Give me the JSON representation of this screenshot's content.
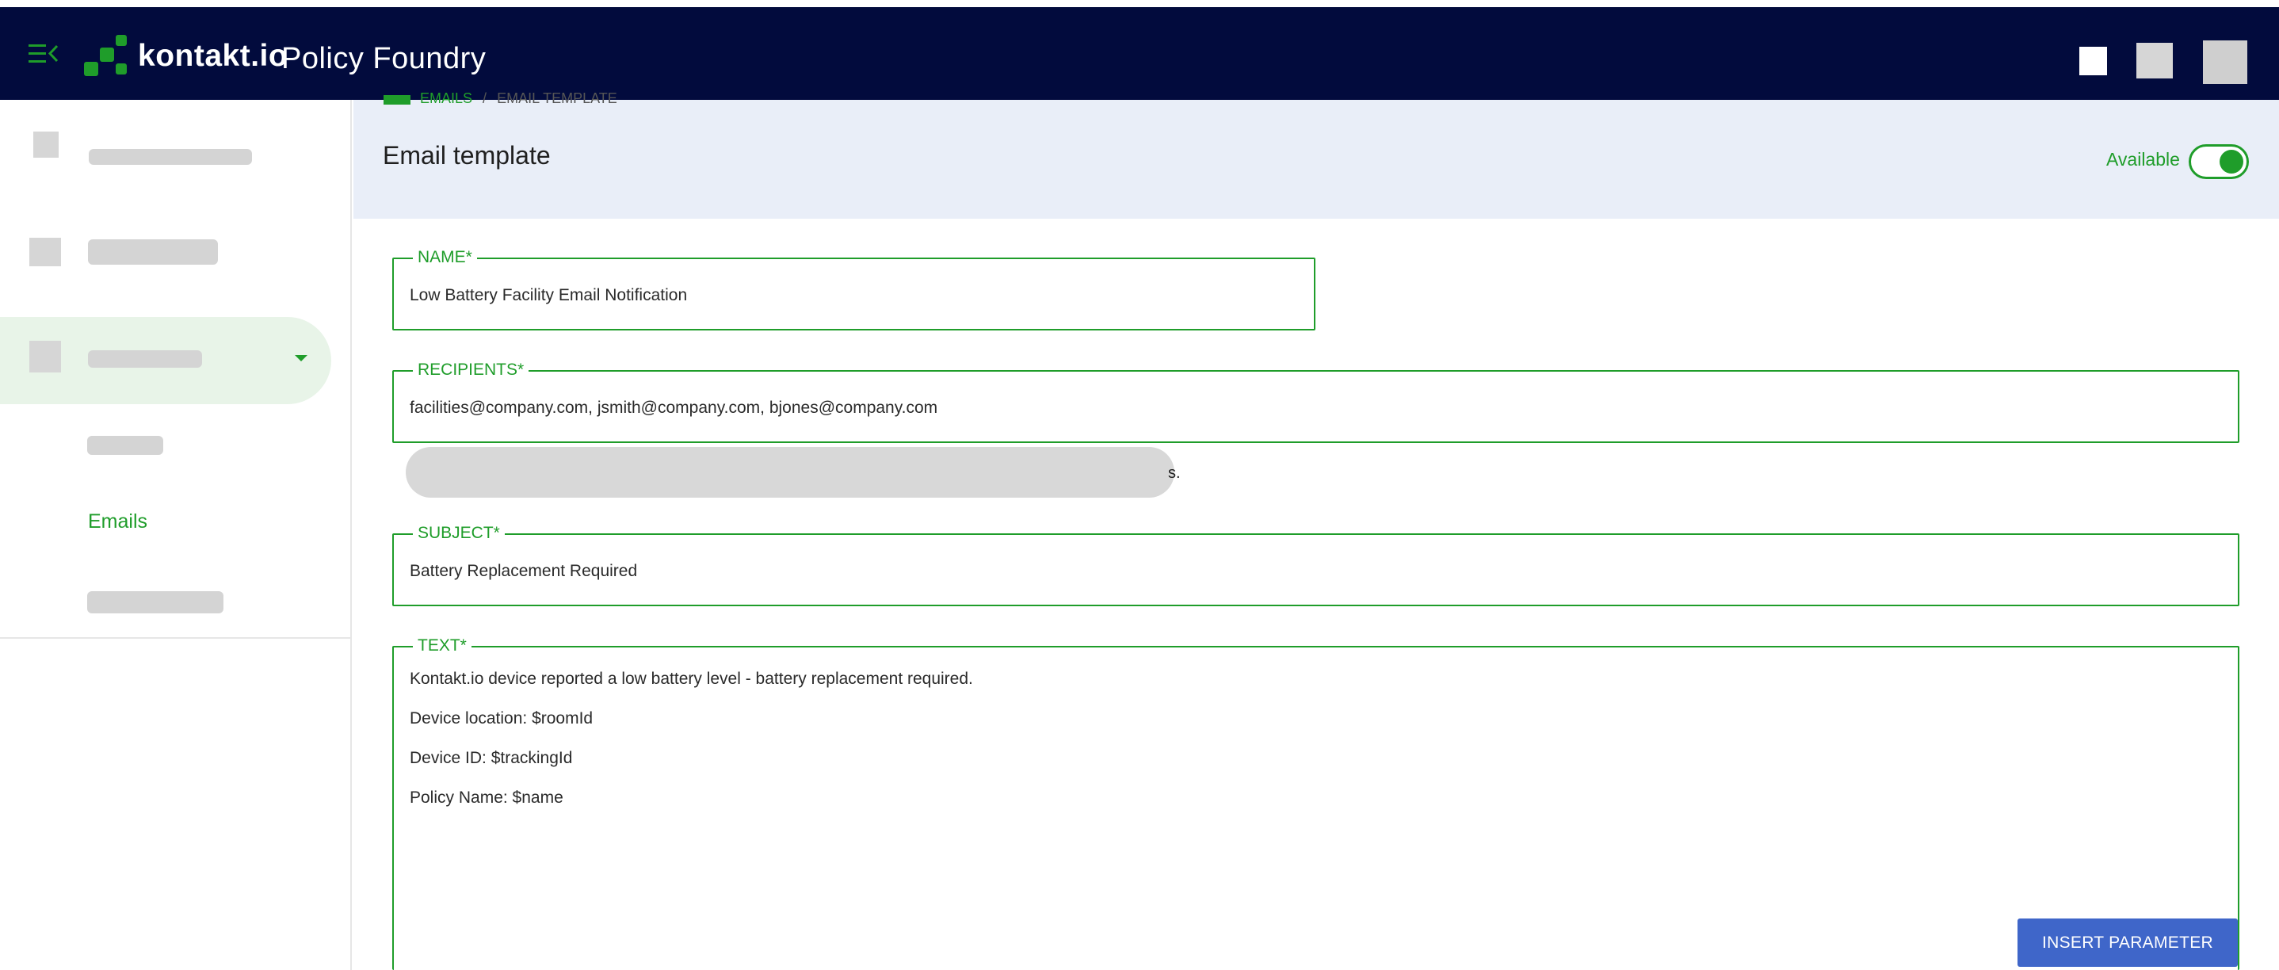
{
  "app": {
    "brand_word": "kontakt.io",
    "title": "Policy Foundry"
  },
  "breadcrumb": {
    "parent": "EMAILS",
    "separator": "/",
    "current": "EMAIL TEMPLATE"
  },
  "sidebar": {
    "active_subitem": "Emails"
  },
  "header": {
    "page_title": "Email template",
    "availability_label": "Available",
    "available": true
  },
  "form": {
    "name": {
      "label": "NAME*",
      "value": "Low Battery Facility Email Notification"
    },
    "recipients": {
      "label": "RECIPIENTS*",
      "value": "facilities@company.com, jsmith@company.com, bjones@company.com",
      "hint_tail": "s."
    },
    "subject": {
      "label": "SUBJECT*",
      "value": "Battery Replacement Required"
    },
    "text": {
      "label": "TEXT*",
      "lines": [
        " Kontakt.io device reported a low battery level - battery replacement required.",
        "Device location: $roomId",
        "Device ID: $trackingId",
        "Policy Name: $name"
      ]
    },
    "insert_parameter_label": "INSERT PARAMETER"
  },
  "colors": {
    "topbar": "#020b3d",
    "accent_green": "#1f9d2a",
    "header_band": "#e9eef8",
    "button_blue": "#3f66c9"
  },
  "icons": {
    "menu_toggle": "menu-collapse-icon",
    "dropdown": "caret-down-icon"
  }
}
